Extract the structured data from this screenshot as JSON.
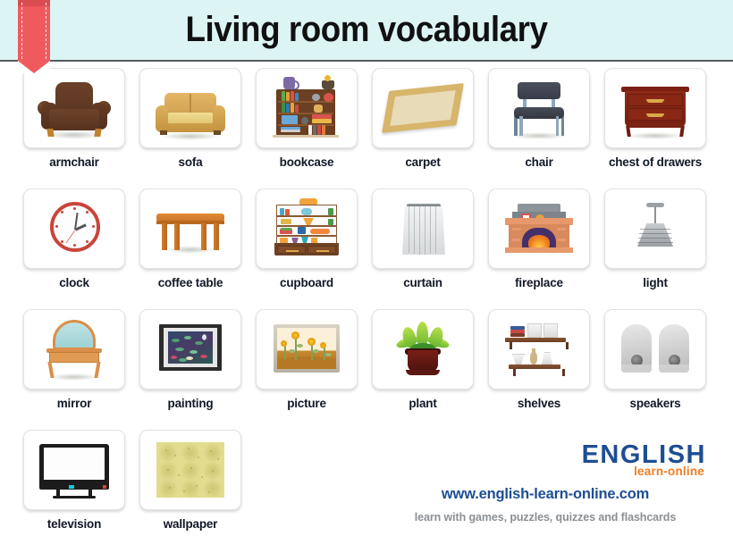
{
  "header": {
    "title": "Living room vocabulary",
    "ribbon_icon": "bookmark-ribbon-icon",
    "background_color": "#dcf5f4"
  },
  "grid": {
    "rows": [
      [
        {
          "label": "armchair",
          "icon": "armchair-icon"
        },
        {
          "label": "sofa",
          "icon": "sofa-icon"
        },
        {
          "label": "bookcase",
          "icon": "bookcase-icon"
        },
        {
          "label": "carpet",
          "icon": "carpet-icon"
        },
        {
          "label": "chair",
          "icon": "chair-icon"
        },
        {
          "label": "chest of drawers",
          "icon": "chest-of-drawers-icon"
        }
      ],
      [
        {
          "label": "clock",
          "icon": "clock-icon"
        },
        {
          "label": "coffee table",
          "icon": "coffee-table-icon"
        },
        {
          "label": "cupboard",
          "icon": "cupboard-icon"
        },
        {
          "label": "curtain",
          "icon": "curtain-icon"
        },
        {
          "label": "fireplace",
          "icon": "fireplace-icon"
        },
        {
          "label": "light",
          "icon": "light-icon"
        }
      ],
      [
        {
          "label": "mirror",
          "icon": "mirror-icon"
        },
        {
          "label": "painting",
          "icon": "painting-icon"
        },
        {
          "label": "picture",
          "icon": "picture-icon"
        },
        {
          "label": "plant",
          "icon": "plant-icon"
        },
        {
          "label": "shelves",
          "icon": "shelves-icon"
        },
        {
          "label": "speakers",
          "icon": "speakers-icon"
        }
      ],
      [
        {
          "label": "television",
          "icon": "television-icon"
        },
        {
          "label": "wallpaper",
          "icon": "wallpaper-icon"
        }
      ]
    ]
  },
  "brand": {
    "logo_main": "ENGLISH",
    "logo_sub": "learn-online",
    "url": "www.english-learn-online.com",
    "tagline": "learn with games, puzzles, quizzes and flashcards",
    "logo_main_color": "#1d4e94",
    "logo_sub_color": "#f07d20",
    "url_color": "#1d4e94",
    "tagline_color": "#8b8f93"
  }
}
